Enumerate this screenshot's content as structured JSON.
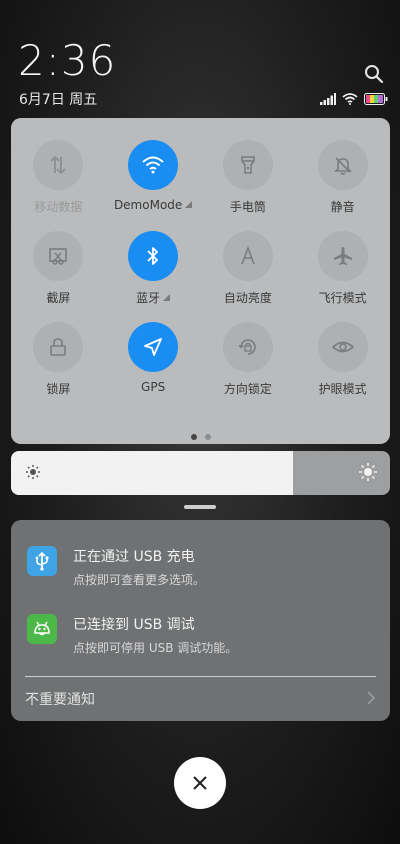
{
  "status": {
    "time": "2:36",
    "date": "6月7日 周五"
  },
  "quick_settings": {
    "tiles": [
      {
        "label": "移动数据",
        "icon": "mobile-data-icon",
        "active": false,
        "dim": true
      },
      {
        "label": "DemoMode",
        "icon": "wifi-icon",
        "active": true,
        "expand": true
      },
      {
        "label": "手电筒",
        "icon": "flashlight-icon",
        "active": false
      },
      {
        "label": "静音",
        "icon": "mute-icon",
        "active": false
      },
      {
        "label": "截屏",
        "icon": "screenshot-icon",
        "active": false
      },
      {
        "label": "蓝牙",
        "icon": "bluetooth-icon",
        "active": true,
        "expand": true
      },
      {
        "label": "自动亮度",
        "icon": "auto-brightness-icon",
        "active": false
      },
      {
        "label": "飞行模式",
        "icon": "airplane-icon",
        "active": false
      },
      {
        "label": "锁屏",
        "icon": "lock-icon",
        "active": false
      },
      {
        "label": "GPS",
        "icon": "location-icon",
        "active": true
      },
      {
        "label": "方向锁定",
        "icon": "rotation-lock-icon",
        "active": false
      },
      {
        "label": "护眼模式",
        "icon": "eye-icon",
        "active": false
      }
    ],
    "page_count": 2,
    "current_page": 0
  },
  "brightness": {
    "level": 0.745
  },
  "notifications": {
    "items": [
      {
        "title": "正在通过 USB 充电",
        "subtitle": "点按即可查看更多选项。",
        "icon": "usb-icon",
        "color": "#3ea4e6"
      },
      {
        "title": "已连接到 USB 调试",
        "subtitle": "点按即可停用 USB 调试功能。",
        "icon": "android-icon",
        "color": "#4db84a"
      }
    ],
    "unimportant_label": "不重要通知"
  },
  "colors": {
    "accent": "#1a8df2"
  }
}
